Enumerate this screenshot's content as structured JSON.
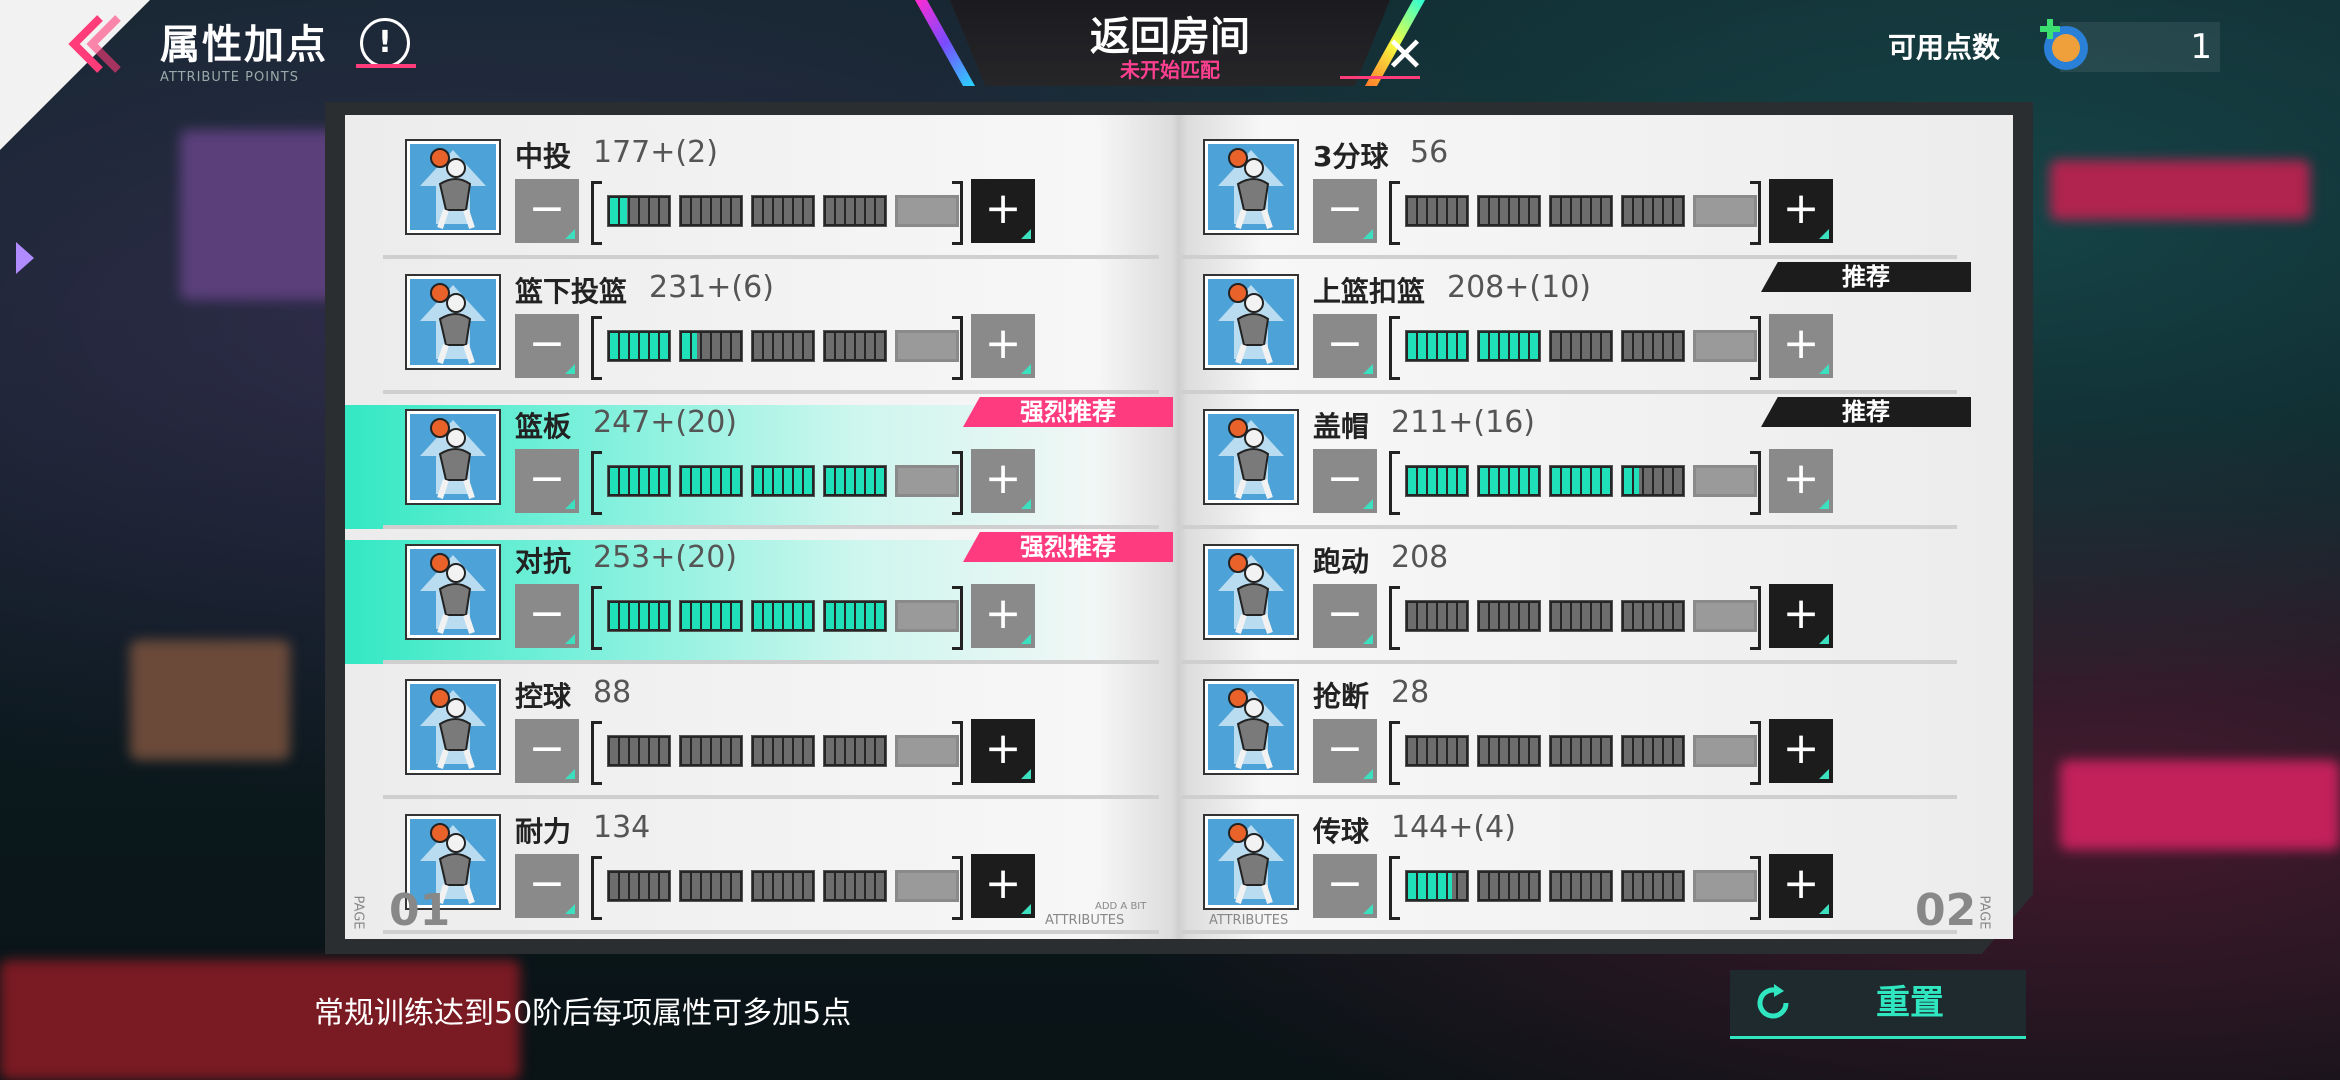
{
  "header": {
    "title": "属性加点",
    "subtitle": "ATTRIBUTE POINTS",
    "info_glyph": "!",
    "return_label": "返回房间",
    "match_status": "未开始匹配",
    "points_label": "可用点数",
    "points_value": "1"
  },
  "tags": {
    "strong": "强烈推荐",
    "recommend": "推荐"
  },
  "left_attributes": [
    {
      "name": "中投",
      "value": "177+(2)",
      "segments": [
        0.3,
        0,
        0,
        0,
        0
      ],
      "plus_active": true,
      "tag": "",
      "highlight": false
    },
    {
      "name": "篮下投篮",
      "value": "231+(6)",
      "segments": [
        1,
        0.25,
        0,
        0,
        0
      ],
      "plus_active": false,
      "tag": "",
      "highlight": false
    },
    {
      "name": "篮板",
      "value": "247+(20)",
      "segments": [
        1,
        1,
        1,
        1,
        0
      ],
      "plus_active": false,
      "tag": "strong",
      "highlight": true
    },
    {
      "name": "对抗",
      "value": "253+(20)",
      "segments": [
        1,
        1,
        1,
        1,
        0
      ],
      "plus_active": false,
      "tag": "strong",
      "highlight": true
    },
    {
      "name": "控球",
      "value": "88",
      "segments": [
        0,
        0,
        0,
        0,
        0
      ],
      "plus_active": true,
      "tag": "",
      "highlight": false
    },
    {
      "name": "耐力",
      "value": "134",
      "segments": [
        0,
        0,
        0,
        0,
        0
      ],
      "plus_active": true,
      "tag": "",
      "highlight": false
    }
  ],
  "right_attributes": [
    {
      "name": "3分球",
      "value": "56",
      "segments": [
        0,
        0,
        0,
        0,
        0
      ],
      "plus_active": true,
      "tag": "",
      "highlight": false
    },
    {
      "name": "上篮扣篮",
      "value": "208+(10)",
      "segments": [
        1,
        1,
        0,
        0,
        0
      ],
      "plus_active": false,
      "tag": "recommend",
      "highlight": false
    },
    {
      "name": "盖帽",
      "value": "211+(16)",
      "segments": [
        1,
        1,
        1,
        0.25,
        0
      ],
      "plus_active": false,
      "tag": "recommend",
      "highlight": false
    },
    {
      "name": "跑动",
      "value": "208",
      "segments": [
        0,
        0,
        0,
        0,
        0
      ],
      "plus_active": true,
      "tag": "",
      "highlight": false
    },
    {
      "name": "抢断",
      "value": "28",
      "segments": [
        0,
        0,
        0,
        0,
        0
      ],
      "plus_active": true,
      "tag": "",
      "highlight": false
    },
    {
      "name": "传球",
      "value": "144+(4)",
      "segments": [
        0.75,
        0,
        0,
        0,
        0
      ],
      "plus_active": true,
      "tag": "",
      "highlight": false
    }
  ],
  "pages": {
    "left_num": "01",
    "right_num": "02",
    "caption_left": "ATTRIBUTES",
    "caption_right": "ATTRIBUTES",
    "caption_small": "ADD A BIT",
    "page_word": "PAGE"
  },
  "footer": {
    "hint": "常规训练达到50阶后每项属性可多加5点",
    "reset_label": "重置"
  },
  "colors": {
    "accent": "#1fe0b8",
    "pink": "#ff3b7f",
    "dark": "#1c1c1c"
  }
}
